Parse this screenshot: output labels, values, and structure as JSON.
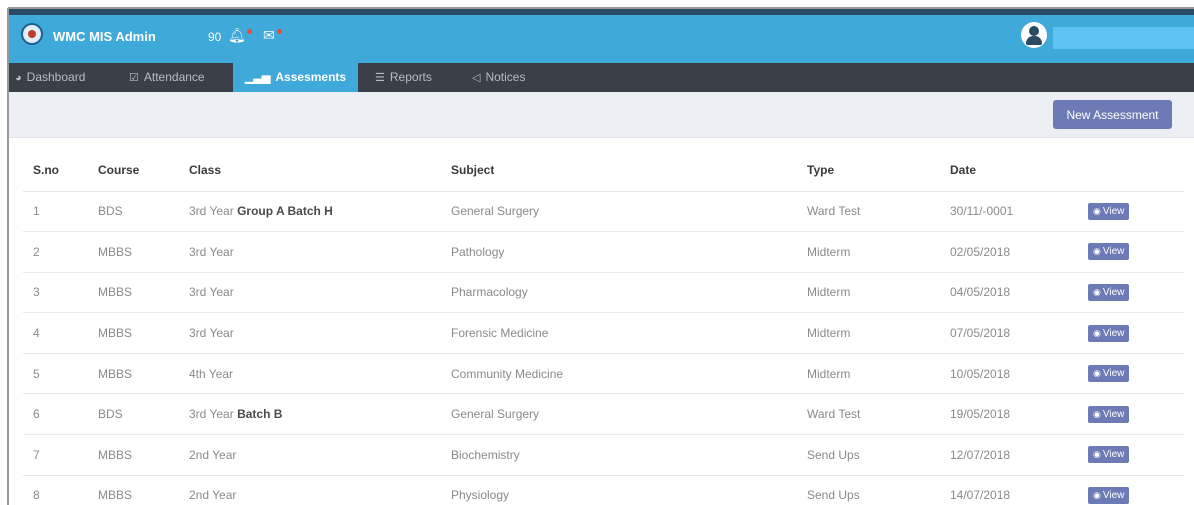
{
  "header": {
    "app_title": "WMC MIS Admin",
    "notification_count": "90",
    "accent_color": "#3fa9da",
    "user_name": ""
  },
  "nav": {
    "items": [
      {
        "label": "Dashboard",
        "icon": "dashboard-icon"
      },
      {
        "label": "Attendance",
        "icon": "checkbox-icon"
      },
      {
        "label": "Assesments",
        "icon": "bar-chart-icon",
        "active": true
      },
      {
        "label": "Reports",
        "icon": "list-icon"
      },
      {
        "label": "Notices",
        "icon": "megaphone-icon"
      }
    ]
  },
  "actions": {
    "new_assessment": "New Assessment"
  },
  "table": {
    "headers": [
      "S.no",
      "Course",
      "Class",
      "Subject",
      "Type",
      "Date"
    ],
    "view_label": "View",
    "rows": [
      {
        "sno": "1",
        "course": "BDS",
        "class_prefix": "3rd Year",
        "class_bold": "Group A Batch H",
        "subject": "General Surgery",
        "type": "Ward Test",
        "date": "30/11/-0001"
      },
      {
        "sno": "2",
        "course": "MBBS",
        "class_prefix": "3rd Year",
        "class_bold": "",
        "subject": "Pathology",
        "type": "Midterm",
        "date": "02/05/2018"
      },
      {
        "sno": "3",
        "course": "MBBS",
        "class_prefix": "3rd Year",
        "class_bold": "",
        "subject": "Pharmacology",
        "type": "Midterm",
        "date": "04/05/2018"
      },
      {
        "sno": "4",
        "course": "MBBS",
        "class_prefix": "3rd Year",
        "class_bold": "",
        "subject": "Forensic Medicine",
        "type": "Midterm",
        "date": "07/05/2018"
      },
      {
        "sno": "5",
        "course": "MBBS",
        "class_prefix": "4th Year",
        "class_bold": "",
        "subject": "Community Medicine",
        "type": "Midterm",
        "date": "10/05/2018"
      },
      {
        "sno": "6",
        "course": "BDS",
        "class_prefix": "3rd Year",
        "class_bold": "Batch B",
        "subject": "General Surgery",
        "type": "Ward Test",
        "date": "19/05/2018"
      },
      {
        "sno": "7",
        "course": "MBBS",
        "class_prefix": "2nd Year",
        "class_bold": "",
        "subject": "Biochemistry",
        "type": "Send Ups",
        "date": "12/07/2018"
      },
      {
        "sno": "8",
        "course": "MBBS",
        "class_prefix": "2nd Year",
        "class_bold": "",
        "subject": "Physiology",
        "type": "Send Ups",
        "date": "14/07/2018"
      }
    ]
  }
}
